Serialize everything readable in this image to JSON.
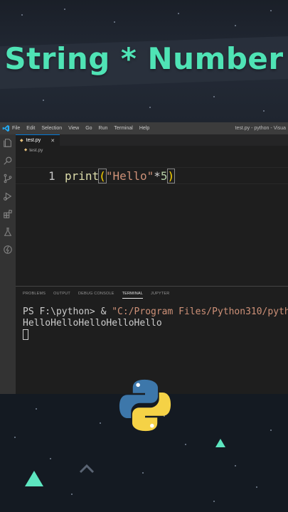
{
  "banner": {
    "title": "String * Number"
  },
  "window": {
    "menu": [
      "File",
      "Edit",
      "Selection",
      "View",
      "Go",
      "Run",
      "Terminal",
      "Help"
    ],
    "title": "test.py - python - Visua"
  },
  "activity_icons": [
    "explorer-icon",
    "search-icon",
    "source-control-icon",
    "run-debug-icon",
    "extensions-icon",
    "testing-icon",
    "remote-icon"
  ],
  "editor": {
    "tab_label": "test.py",
    "breadcrumb": "test.py",
    "line_number": "1",
    "code": {
      "fn": "print",
      "open": "(",
      "str": "\"Hello\"",
      "op": "*",
      "num": "5",
      "close": ")"
    }
  },
  "panel": {
    "tabs": [
      "PROBLEMS",
      "OUTPUT",
      "DEBUG CONSOLE",
      "TERMINAL",
      "JUPYTER"
    ],
    "active_tab": "TERMINAL",
    "prompt": "PS F:\\python> & ",
    "command_path": "\"C:/Program Files/Python310/pyth",
    "output": "HelloHelloHelloHelloHello"
  },
  "colors": {
    "title_accent": "#4fe3b5",
    "vscode_blue": "#0078d4",
    "decor_triangle": "#5de6c0"
  }
}
